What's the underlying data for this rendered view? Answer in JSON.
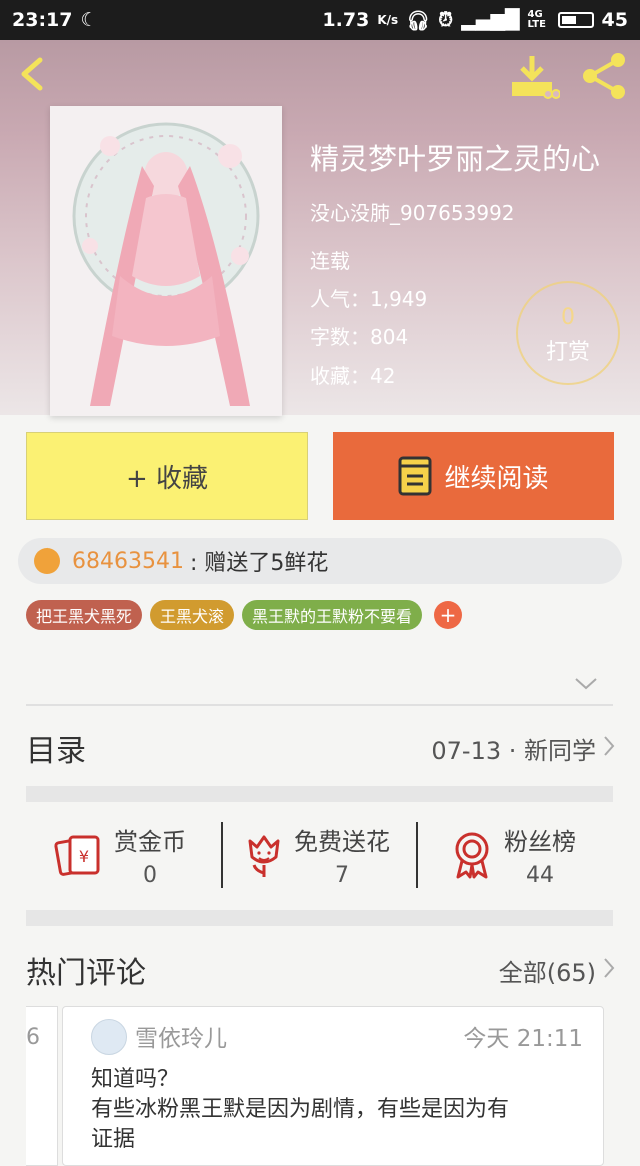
{
  "status_bar": {
    "time": "23:17",
    "speed": "1.73",
    "speed_unit": "K/s",
    "network": "4G LTE",
    "battery": "45"
  },
  "book": {
    "title": "精灵梦叶罗丽之灵的心",
    "author": "没心没肺_907653992",
    "status": "连载",
    "popularity": "人气：1,949",
    "word_count": "字数：804",
    "favorites": "收藏：42",
    "tip_count": "0",
    "tip_label": "打赏"
  },
  "actions": {
    "collect_label": "+ 收藏",
    "read_label": "继续阅读"
  },
  "gift_notice": {
    "user_id": "68463541",
    "message": ": 赠送了5鲜花"
  },
  "tags": [
    {
      "label": "把王黑犬黑死",
      "color": "#c0614f"
    },
    {
      "label": "王黑犬滚",
      "color": "#d19b2f"
    },
    {
      "label": "黑王默的王默粉不要看",
      "color": "#7fae4a"
    }
  ],
  "tag_add": "+",
  "catalog": {
    "label": "目录",
    "latest": "07-13 · 新同学"
  },
  "stats": [
    {
      "label": "赏金币",
      "value": "0",
      "icon": "red-envelope-icon"
    },
    {
      "label": "免费送花",
      "value": "7",
      "icon": "flower-icon"
    },
    {
      "label": "粉丝榜",
      "value": "44",
      "icon": "medal-icon"
    }
  ],
  "comments": {
    "heading": "热门评论",
    "all_link": "全部(65)",
    "prev_card_fragment": "6",
    "first": {
      "user": "雪依玲儿",
      "time": "今天 21:11",
      "line1": "知道吗？",
      "line2": "有些冰粉黑王默是因为剧情，有些是因为有",
      "line3": "证据"
    }
  },
  "colors": {
    "accent_orange": "#e96a3c",
    "collect_yellow": "#fbf173",
    "icon_red": "#c9302c"
  }
}
